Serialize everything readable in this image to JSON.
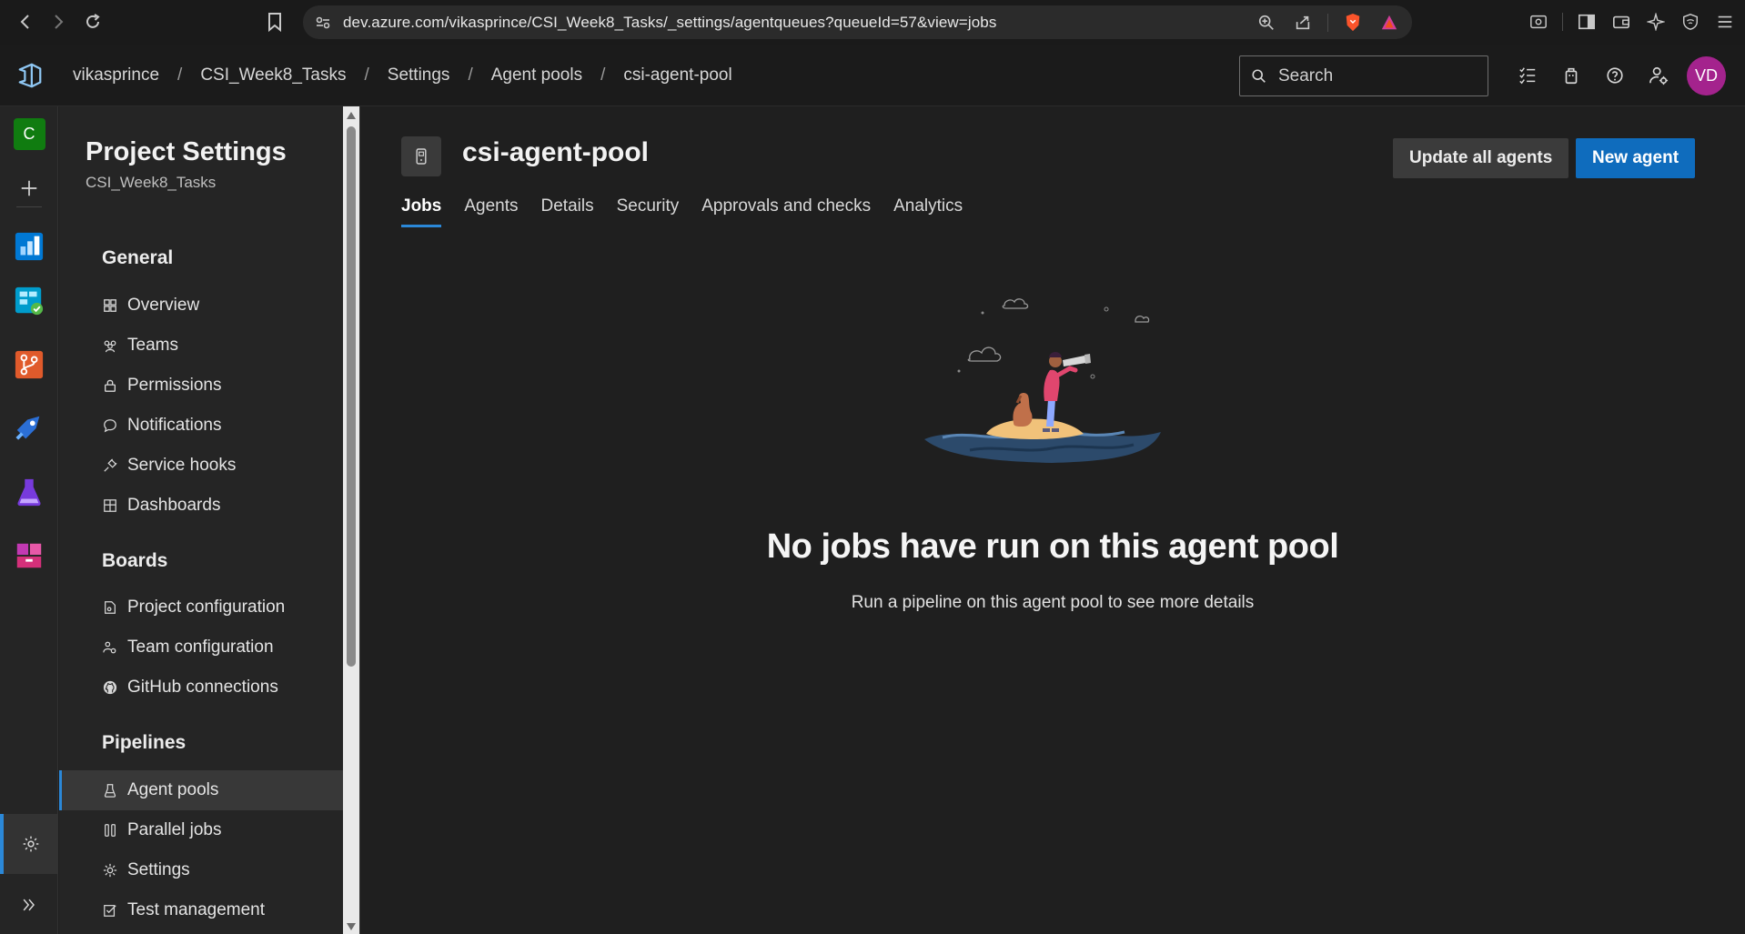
{
  "browser": {
    "url": "dev.azure.com/vikasprince/CSI_Week8_Tasks/_settings/agentqueues?queueId=57&view=jobs"
  },
  "header": {
    "breadcrumbs": [
      "vikasprince",
      "CSI_Week8_Tasks",
      "Settings",
      "Agent pools",
      "csi-agent-pool"
    ],
    "search_placeholder": "Search",
    "avatar_initials": "VD"
  },
  "rail": {
    "project_initial": "C"
  },
  "sidebar": {
    "title": "Project Settings",
    "subtitle": "CSI_Week8_Tasks",
    "groups": [
      {
        "heading": "General",
        "items": [
          {
            "label": "Overview",
            "icon": "overview-icon"
          },
          {
            "label": "Teams",
            "icon": "teams-icon"
          },
          {
            "label": "Permissions",
            "icon": "lock-icon"
          },
          {
            "label": "Notifications",
            "icon": "chat-icon"
          },
          {
            "label": "Service hooks",
            "icon": "plug-icon"
          },
          {
            "label": "Dashboards",
            "icon": "dashboard-icon"
          }
        ]
      },
      {
        "heading": "Boards",
        "items": [
          {
            "label": "Project configuration",
            "icon": "doc-gear-icon"
          },
          {
            "label": "Team configuration",
            "icon": "team-gear-icon"
          },
          {
            "label": "GitHub connections",
            "icon": "github-icon"
          }
        ]
      },
      {
        "heading": "Pipelines",
        "items": [
          {
            "label": "Agent pools",
            "icon": "agent-pool-icon"
          },
          {
            "label": "Parallel jobs",
            "icon": "parallel-icon"
          },
          {
            "label": "Settings",
            "icon": "gear-icon"
          },
          {
            "label": "Test management",
            "icon": "test-icon"
          }
        ]
      }
    ]
  },
  "main": {
    "pool_name": "csi-agent-pool",
    "update_button": "Update all agents",
    "new_agent_button": "New agent",
    "tabs": [
      "Jobs",
      "Agents",
      "Details",
      "Security",
      "Approvals and checks",
      "Analytics"
    ],
    "active_tab": "Jobs",
    "empty_title": "No jobs have run on this agent pool",
    "empty_subtitle": "Run a pipeline on this agent pool to see more details"
  },
  "colors": {
    "accent": "#0f6cbd",
    "avatar": "#a4238d",
    "selection_bar": "#2b88d8"
  }
}
